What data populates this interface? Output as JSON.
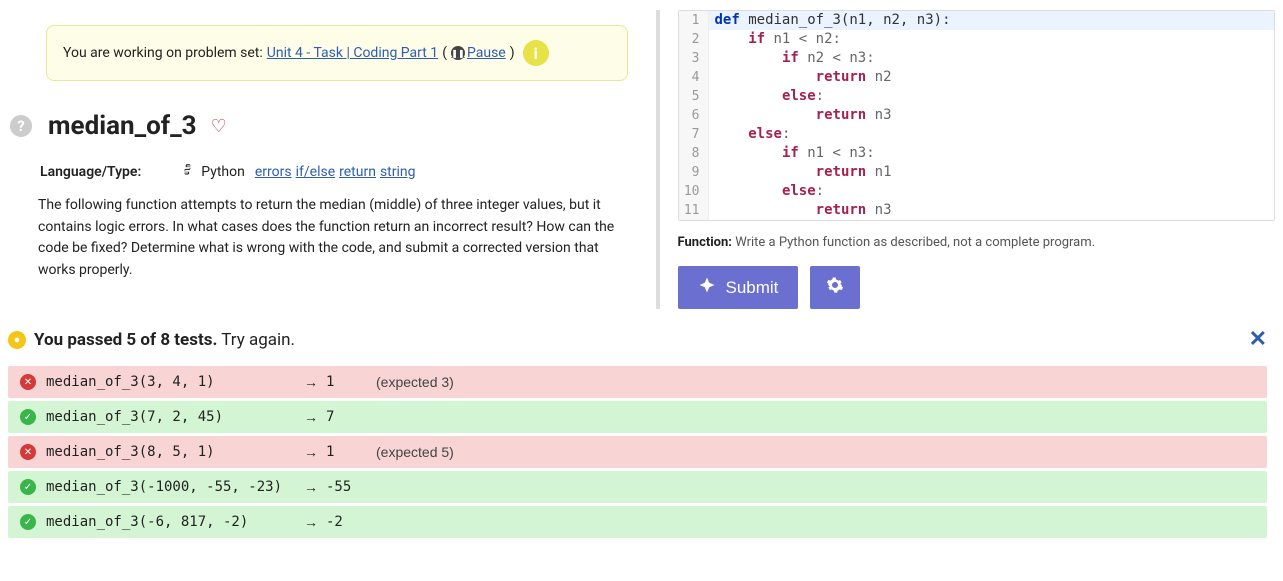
{
  "notice": {
    "prefix": "You are working on problem set: ",
    "link_text": "Unit 4 - Task | Coding Part 1",
    "pause_text": " Pause"
  },
  "problem": {
    "title": "median_of_3",
    "lang_label": "Language/Type:",
    "lang_name": "Python",
    "tags": [
      "errors",
      "if/else",
      "return",
      "string"
    ],
    "description": "The following function attempts to return the median (middle) of three integer values, but it contains logic errors. In what cases does the function return an incorrect result? How can the code be fixed? Determine what is wrong with the code, and submit a corrected version that works properly."
  },
  "code_lines": [
    {
      "n": "1",
      "content": [
        {
          "t": "kw",
          "v": "def "
        },
        {
          "t": "fn",
          "v": "median_of_3(n1, n2, n3):"
        }
      ],
      "hl": true
    },
    {
      "n": "2",
      "content": [
        {
          "t": "",
          "v": "    "
        },
        {
          "t": "kw2",
          "v": "if"
        },
        {
          "t": "op",
          "v": " n1 < n2:"
        }
      ]
    },
    {
      "n": "3",
      "content": [
        {
          "t": "",
          "v": "        "
        },
        {
          "t": "kw2",
          "v": "if"
        },
        {
          "t": "op",
          "v": " n2 < n3:"
        }
      ]
    },
    {
      "n": "4",
      "content": [
        {
          "t": "",
          "v": "            "
        },
        {
          "t": "kw2",
          "v": "return"
        },
        {
          "t": "op",
          "v": " n2"
        }
      ]
    },
    {
      "n": "5",
      "content": [
        {
          "t": "",
          "v": "        "
        },
        {
          "t": "kw2",
          "v": "else"
        },
        {
          "t": "op",
          "v": ":"
        }
      ]
    },
    {
      "n": "6",
      "content": [
        {
          "t": "",
          "v": "            "
        },
        {
          "t": "kw2",
          "v": "return"
        },
        {
          "t": "op",
          "v": " n3"
        }
      ]
    },
    {
      "n": "7",
      "content": [
        {
          "t": "",
          "v": "    "
        },
        {
          "t": "kw2",
          "v": "else"
        },
        {
          "t": "op",
          "v": ":"
        }
      ]
    },
    {
      "n": "8",
      "content": [
        {
          "t": "",
          "v": "        "
        },
        {
          "t": "kw2",
          "v": "if"
        },
        {
          "t": "op",
          "v": " n1 < n3:"
        }
      ]
    },
    {
      "n": "9",
      "content": [
        {
          "t": "",
          "v": "            "
        },
        {
          "t": "kw2",
          "v": "return"
        },
        {
          "t": "op",
          "v": " n1"
        }
      ]
    },
    {
      "n": "10",
      "content": [
        {
          "t": "",
          "v": "        "
        },
        {
          "t": "kw2",
          "v": "else"
        },
        {
          "t": "op",
          "v": ":"
        }
      ]
    },
    {
      "n": "11",
      "content": [
        {
          "t": "",
          "v": "            "
        },
        {
          "t": "kw2",
          "v": "return"
        },
        {
          "t": "op",
          "v": " n3"
        }
      ]
    }
  ],
  "function_hint_label": "Function:",
  "function_hint_text": " Write a Python function as described, not a complete program.",
  "submit_label": "Submit",
  "results": {
    "summary_bold": "You passed 5 of 8 tests.",
    "summary_rest": " Try again.",
    "tests": [
      {
        "pass": false,
        "call": "median_of_3(3, 4, 1)",
        "result": "1",
        "expected": "(expected 3)"
      },
      {
        "pass": true,
        "call": "median_of_3(7, 2, 45)",
        "result": "7",
        "expected": ""
      },
      {
        "pass": false,
        "call": "median_of_3(8, 5, 1)",
        "result": "1",
        "expected": "(expected 5)"
      },
      {
        "pass": true,
        "call": "median_of_3(-1000, -55, -23)",
        "result": "-55",
        "expected": ""
      },
      {
        "pass": true,
        "call": "median_of_3(-6, 817, -2)",
        "result": "-2",
        "expected": ""
      }
    ]
  }
}
